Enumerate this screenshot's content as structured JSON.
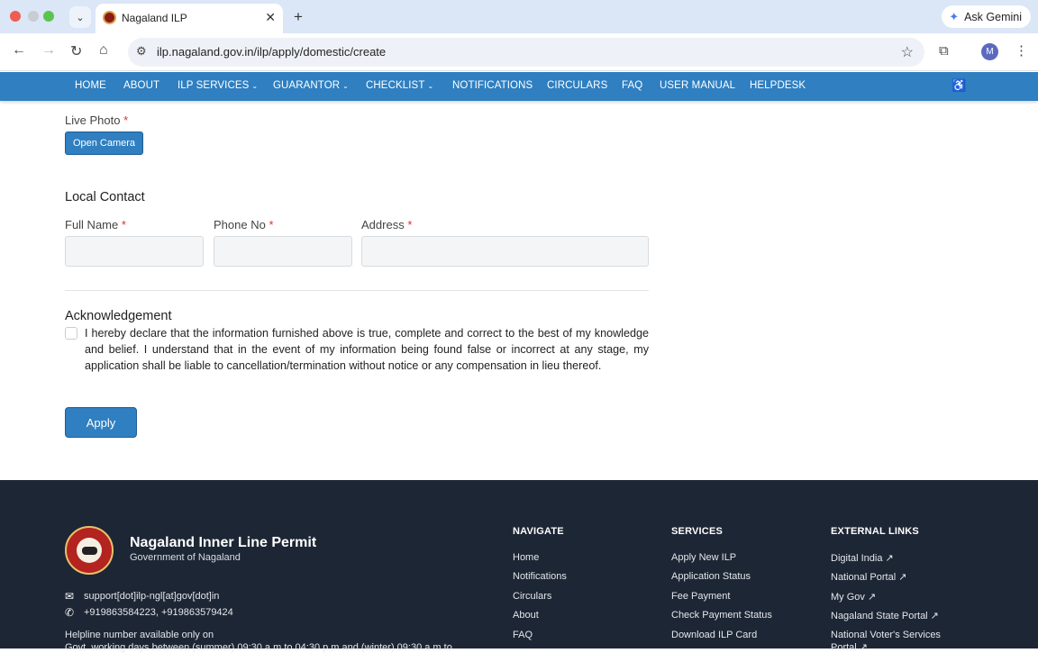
{
  "browser": {
    "tab_title": "Nagaland ILP",
    "new_tab": "+",
    "gemini_label": "Ask Gemini",
    "url": "ilp.nagaland.gov.in/ilp/apply/domestic/create",
    "avatar_letter": "M"
  },
  "nav": {
    "items": [
      "HOME",
      "ABOUT",
      "ILP SERVICES",
      "GUARANTOR",
      "CHECKLIST",
      "NOTIFICATIONS",
      "CIRCULARS",
      "FAQ",
      "USER MANUAL",
      "HELPDESK"
    ]
  },
  "form": {
    "live_photo_label": "Live Photo",
    "required_mark": "*",
    "open_camera": "Open Camera",
    "local_contact_title": "Local Contact",
    "full_name_label": "Full Name",
    "phone_label": "Phone No",
    "address_label": "Address",
    "full_name_value": "",
    "phone_value": "",
    "address_value": "",
    "ack_title": "Acknowledgement",
    "ack_text": "I hereby declare that the information furnished above is true, complete and correct to the best of my knowledge and belief. I understand that in the event of my information being found false or incorrect at any stage, my application shall be liable to cancellation/termination without notice or any compensation in lieu thereof.",
    "ack_checked": false,
    "apply": "Apply"
  },
  "footer": {
    "title": "Nagaland Inner Line Permit",
    "subtitle": "Government of Nagaland",
    "email": "support[dot]ilp-ngl[at]gov[dot]in",
    "phone": "+919863584223, +919863579424",
    "helpline_1": "Helpline number available only on",
    "helpline_2": "Govt. working days between (summer) 09:30 a.m to 04:30 p.m and (winter) 09:30 a.m to",
    "navigate": {
      "heading": "NAVIGATE",
      "links": [
        "Home",
        "Notifications",
        "Circulars",
        "About",
        "FAQ"
      ]
    },
    "services": {
      "heading": "SERVICES",
      "links": [
        "Apply New ILP",
        "Application Status",
        "Fee Payment",
        "Check Payment Status",
        "Download ILP Card"
      ]
    },
    "external": {
      "heading": "EXTERNAL LINKS",
      "links": [
        "Digital India ↗",
        "National Portal ↗",
        "My Gov ↗",
        "Nagaland State Portal ↗",
        "National Voter's Services",
        "Portal ↗"
      ]
    }
  },
  "colors": {
    "nav_blue": "#2f7fc1",
    "footer_bg": "#1d2634",
    "required_red": "#d9342b"
  }
}
